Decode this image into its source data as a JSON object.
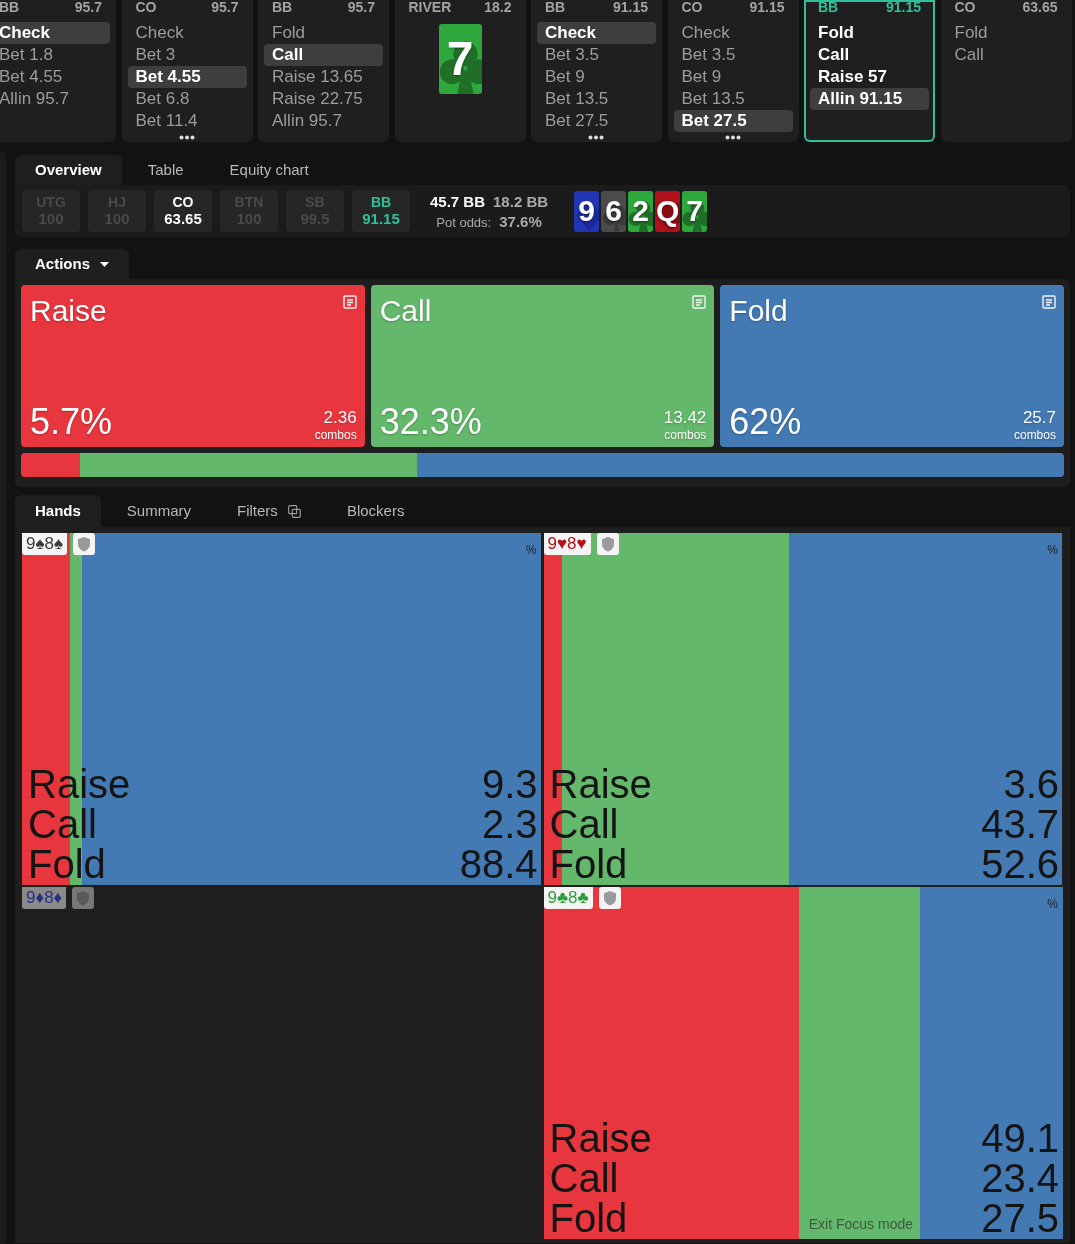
{
  "history": [
    {
      "kind": "actions",
      "position": "BB",
      "stack": "95.7",
      "current": false,
      "more": false,
      "actions": [
        {
          "label": "Check",
          "selected": true
        },
        {
          "label": "Bet 1.8",
          "selected": false
        },
        {
          "label": "Bet 4.55",
          "selected": false
        },
        {
          "label": "Allin 95.7",
          "selected": false
        }
      ]
    },
    {
      "kind": "actions",
      "position": "CO",
      "stack": "95.7",
      "current": false,
      "more": true,
      "actions": [
        {
          "label": "Check",
          "selected": false
        },
        {
          "label": "Bet 3",
          "selected": false
        },
        {
          "label": "Bet 4.55",
          "selected": true
        },
        {
          "label": "Bet 6.8",
          "selected": false
        },
        {
          "label": "Bet 11.4",
          "selected": false
        }
      ]
    },
    {
      "kind": "actions",
      "position": "BB",
      "stack": "95.7",
      "current": false,
      "more": false,
      "actions": [
        {
          "label": "Fold",
          "selected": false
        },
        {
          "label": "Call",
          "selected": true
        },
        {
          "label": "Raise 13.65",
          "selected": false
        },
        {
          "label": "Raise 22.75",
          "selected": false
        },
        {
          "label": "Allin 95.7",
          "selected": false
        }
      ]
    },
    {
      "kind": "street",
      "street": "RIVER",
      "pot": "18.2",
      "card": {
        "rank": "7",
        "kind": "club"
      }
    },
    {
      "kind": "actions",
      "position": "BB",
      "stack": "91.15",
      "current": false,
      "more": true,
      "actions": [
        {
          "label": "Check",
          "selected": true
        },
        {
          "label": "Bet 3.5",
          "selected": false
        },
        {
          "label": "Bet 9",
          "selected": false
        },
        {
          "label": "Bet 13.5",
          "selected": false
        },
        {
          "label": "Bet 27.5",
          "selected": false
        }
      ]
    },
    {
      "kind": "actions",
      "position": "CO",
      "stack": "91.15",
      "current": false,
      "more": true,
      "actions": [
        {
          "label": "Check",
          "selected": false
        },
        {
          "label": "Bet 3.5",
          "selected": false
        },
        {
          "label": "Bet 9",
          "selected": false
        },
        {
          "label": "Bet 13.5",
          "selected": false
        },
        {
          "label": "Bet 27.5",
          "selected": true
        }
      ]
    },
    {
      "kind": "actions",
      "position": "BB",
      "stack": "91.15",
      "current": true,
      "more": false,
      "actions": [
        {
          "label": "Fold",
          "selected": false
        },
        {
          "label": "Call",
          "selected": false
        },
        {
          "label": "Raise 57",
          "selected": false
        },
        {
          "label": "Allin 91.15",
          "selected": true
        }
      ]
    },
    {
      "kind": "actions",
      "position": "CO",
      "stack": "63.65",
      "current": false,
      "more": false,
      "actions": [
        {
          "label": "Fold",
          "selected": false
        },
        {
          "label": "Call",
          "selected": false
        }
      ]
    }
  ],
  "overview": {
    "tabs": [
      {
        "label": "Overview",
        "selected": true
      },
      {
        "label": "Table",
        "selected": false
      },
      {
        "label": "Equity chart",
        "selected": false
      }
    ],
    "positions": [
      {
        "name": "UTG",
        "stack": "100",
        "folded": true,
        "current": false
      },
      {
        "name": "HJ",
        "stack": "100",
        "folded": true,
        "current": false
      },
      {
        "name": "CO",
        "stack": "63.65",
        "folded": false,
        "current": false
      },
      {
        "name": "BTN",
        "stack": "100",
        "folded": true,
        "current": false
      },
      {
        "name": "SB",
        "stack": "99.5",
        "folded": true,
        "current": false
      },
      {
        "name": "BB",
        "stack": "91.15",
        "folded": false,
        "current": true
      }
    ],
    "pot": "45.7 BB",
    "bet": "18.2 BB",
    "pot_odds_label": "Pot odds:",
    "pot_odds": "37.6%",
    "board": [
      {
        "rank": "9",
        "kind": "diamond"
      },
      {
        "rank": "6",
        "kind": "spade"
      },
      {
        "rank": "2",
        "kind": "club"
      },
      {
        "rank": "Q",
        "kind": "heart"
      },
      {
        "rank": "7",
        "kind": "club"
      }
    ]
  },
  "actions_panel": {
    "tab": "Actions",
    "actions": [
      {
        "kind": "raise",
        "label": "Raise",
        "frequency": "5.7%",
        "combos": "2.36",
        "combos_label": "combos"
      },
      {
        "kind": "call",
        "label": "Call",
        "frequency": "32.3%",
        "combos": "13.42",
        "combos_label": "combos"
      },
      {
        "kind": "fold",
        "label": "Fold",
        "frequency": "62%",
        "combos": "25.7",
        "combos_label": "combos"
      }
    ]
  },
  "hands_panel": {
    "tabs": [
      {
        "label": "Hands",
        "selected": true,
        "kind": "plain"
      },
      {
        "label": "Summary",
        "selected": false,
        "kind": "plain"
      },
      {
        "label": "Filters",
        "selected": false,
        "kind": "with_icon"
      },
      {
        "label": "Blockers",
        "selected": false,
        "kind": "plain"
      }
    ],
    "hands": [
      {
        "label": "9♠8♠",
        "kind": "spade",
        "in_range": true,
        "percent_sign": "%",
        "strategy": [
          {
            "kind": "raise",
            "label": "Raise",
            "value": "9.3"
          },
          {
            "kind": "call",
            "label": "Call",
            "value": "2.3"
          },
          {
            "kind": "fold",
            "label": "Fold",
            "value": "88.4"
          }
        ]
      },
      {
        "label": "9♥8♥",
        "kind": "heart",
        "in_range": true,
        "percent_sign": "%",
        "strategy": [
          {
            "kind": "raise",
            "label": "Raise",
            "value": "3.6"
          },
          {
            "kind": "call",
            "label": "Call",
            "value": "43.7"
          },
          {
            "kind": "fold",
            "label": "Fold",
            "value": "52.6"
          }
        ]
      },
      {
        "label": "9♦8♦",
        "kind": "diamond",
        "in_range": false
      },
      {
        "label": "9♣8♣",
        "kind": "club",
        "in_range": true,
        "percent_sign": "%",
        "strategy": [
          {
            "kind": "raise",
            "label": "Raise",
            "value": "49.1"
          },
          {
            "kind": "call",
            "label": "Call",
            "value": "23.4"
          },
          {
            "kind": "fold",
            "label": "Fold",
            "value": "27.5"
          }
        ]
      }
    ]
  },
  "exit_focus_mode": "Exit Focus mode"
}
